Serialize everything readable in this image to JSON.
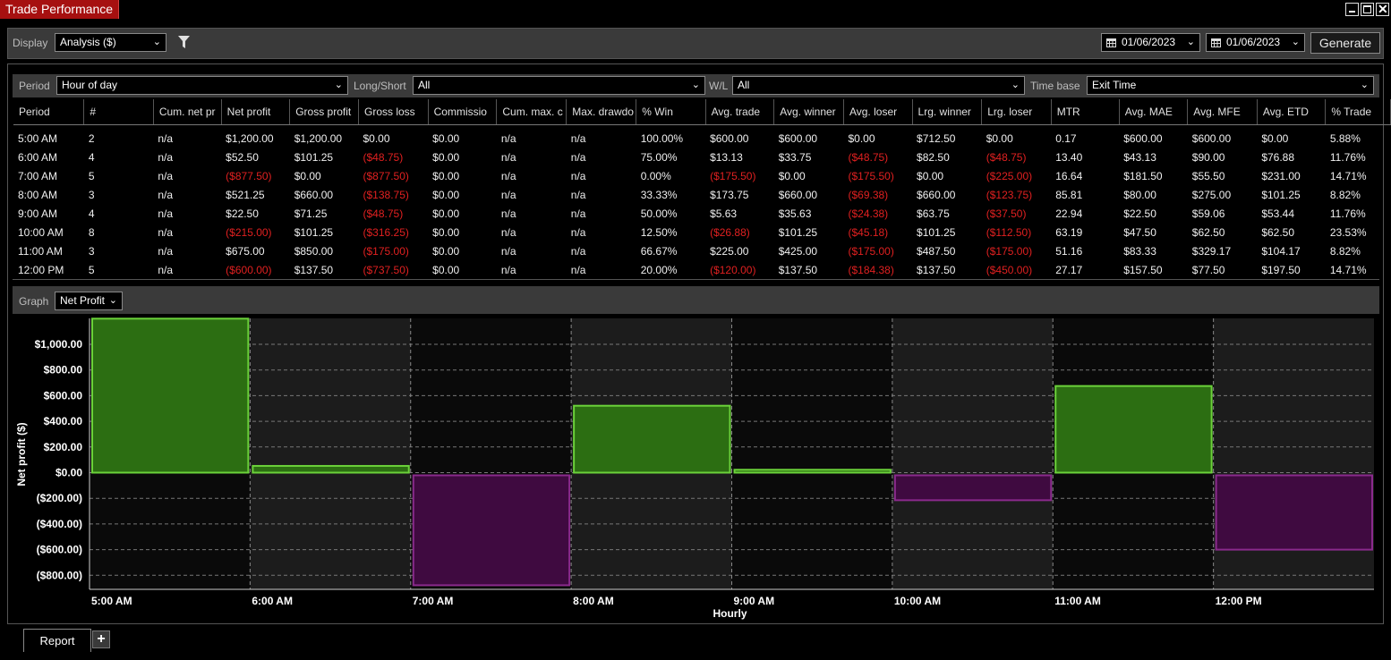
{
  "window": {
    "title": "Trade Performance",
    "minimize_glyph": "_",
    "restore_glyph": "❐",
    "close_glyph": "✕"
  },
  "toolbar": {
    "display_label": "Display",
    "display_value": "Analysis ($)",
    "filter_icon": "funnel-icon",
    "from_date": "01/06/2023",
    "to_date": "01/06/2023",
    "generate_label": "Generate"
  },
  "filters": {
    "period_label": "Period",
    "period_value": "Hour of day",
    "longshort_label": "Long/Short",
    "longshort_value": "All",
    "wl_label": "W/L",
    "wl_value": "All",
    "timebase_label": "Time base",
    "timebase_value": "Exit Time"
  },
  "table": {
    "columns": [
      "Period",
      "#",
      "Cum. net pr",
      "Net profit",
      "Gross profit",
      "Gross loss",
      "Commissio",
      "Cum. max. c",
      "Max. drawdo",
      "% Win",
      "Avg. trade",
      "Avg. winner",
      "Avg. loser",
      "Lrg. winner",
      "Lrg. loser",
      "MTR",
      "Avg. MAE",
      "Avg. MFE",
      "Avg. ETD",
      "% Trade"
    ],
    "rows": [
      [
        "5:00 AM",
        "2",
        "n/a",
        "$1,200.00",
        "$1,200.00",
        "$0.00",
        "$0.00",
        "n/a",
        "n/a",
        "100.00%",
        "$600.00",
        "$600.00",
        "$0.00",
        "$712.50",
        "$0.00",
        "0.17",
        "$600.00",
        "$600.00",
        "$0.00",
        "5.88%"
      ],
      [
        "6:00 AM",
        "4",
        "n/a",
        "$52.50",
        "$101.25",
        "($48.75)",
        "$0.00",
        "n/a",
        "n/a",
        "75.00%",
        "$13.13",
        "$33.75",
        "($48.75)",
        "$82.50",
        "($48.75)",
        "13.40",
        "$43.13",
        "$90.00",
        "$76.88",
        "11.76%"
      ],
      [
        "7:00 AM",
        "5",
        "n/a",
        "($877.50)",
        "$0.00",
        "($877.50)",
        "$0.00",
        "n/a",
        "n/a",
        "0.00%",
        "($175.50)",
        "$0.00",
        "($175.50)",
        "$0.00",
        "($225.00)",
        "16.64",
        "$181.50",
        "$55.50",
        "$231.00",
        "14.71%"
      ],
      [
        "8:00 AM",
        "3",
        "n/a",
        "$521.25",
        "$660.00",
        "($138.75)",
        "$0.00",
        "n/a",
        "n/a",
        "33.33%",
        "$173.75",
        "$660.00",
        "($69.38)",
        "$660.00",
        "($123.75)",
        "85.81",
        "$80.00",
        "$275.00",
        "$101.25",
        "8.82%"
      ],
      [
        "9:00 AM",
        "4",
        "n/a",
        "$22.50",
        "$71.25",
        "($48.75)",
        "$0.00",
        "n/a",
        "n/a",
        "50.00%",
        "$5.63",
        "$35.63",
        "($24.38)",
        "$63.75",
        "($37.50)",
        "22.94",
        "$22.50",
        "$59.06",
        "$53.44",
        "11.76%"
      ],
      [
        "10:00 AM",
        "8",
        "n/a",
        "($215.00)",
        "$101.25",
        "($316.25)",
        "$0.00",
        "n/a",
        "n/a",
        "12.50%",
        "($26.88)",
        "$101.25",
        "($45.18)",
        "$101.25",
        "($112.50)",
        "63.19",
        "$47.50",
        "$62.50",
        "$62.50",
        "23.53%"
      ],
      [
        "11:00 AM",
        "3",
        "n/a",
        "$675.00",
        "$850.00",
        "($175.00)",
        "$0.00",
        "n/a",
        "n/a",
        "66.67%",
        "$225.00",
        "$425.00",
        "($175.00)",
        "$487.50",
        "($175.00)",
        "51.16",
        "$83.33",
        "$329.17",
        "$104.17",
        "8.82%"
      ],
      [
        "12:00 PM",
        "5",
        "n/a",
        "($600.00)",
        "$137.50",
        "($737.50)",
        "$0.00",
        "n/a",
        "n/a",
        "20.00%",
        "($120.00)",
        "$137.50",
        "($184.38)",
        "$137.50",
        "($450.00)",
        "27.17",
        "$157.50",
        "$77.50",
        "$197.50",
        "14.71%"
      ]
    ]
  },
  "graph": {
    "label": "Graph",
    "selected": "Net Profit"
  },
  "chart_data": {
    "type": "bar",
    "title": "",
    "xlabel": "Hourly",
    "ylabel": "Net profit ($)",
    "categories": [
      "5:00 AM",
      "6:00 AM",
      "7:00 AM",
      "8:00 AM",
      "9:00 AM",
      "10:00 AM",
      "11:00 AM",
      "12:00 PM"
    ],
    "values": [
      1200.0,
      52.5,
      -877.5,
      521.25,
      22.5,
      -215.0,
      675.0,
      -600.0
    ],
    "ylim": [
      -900,
      1200
    ],
    "yticks": [
      1000,
      800,
      600,
      400,
      200,
      0,
      -200,
      -400,
      -600,
      -800
    ],
    "ytick_labels": [
      "$1,000.00",
      "$800.00",
      "$600.00",
      "$400.00",
      "$200.00",
      "$0.00",
      "($200.00)",
      "($400.00)",
      "($600.00)",
      "($800.00)"
    ],
    "grid": true,
    "colors": {
      "positive_fill": "#2c6e12",
      "positive_edge": "#6bd23a",
      "negative_fill": "#3f0a40",
      "negative_edge": "#8a2a8c",
      "band_dark": "#0a0a0a",
      "band_light": "#1c1c1c"
    }
  },
  "tabs": {
    "report_label": "Report",
    "add_label": "+"
  }
}
